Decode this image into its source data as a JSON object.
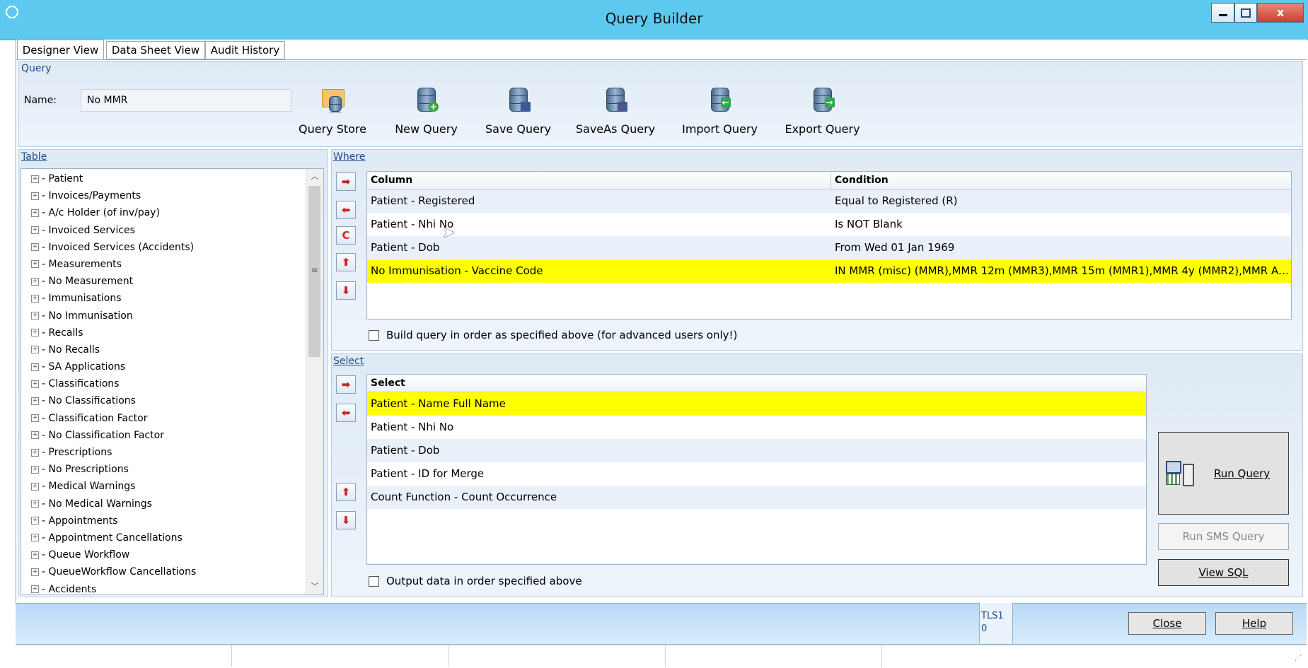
{
  "window": {
    "title": "Query Builder"
  },
  "tabs": [
    {
      "label": "Designer View"
    },
    {
      "label": "Data Sheet View"
    },
    {
      "label": "Audit History"
    }
  ],
  "query_section": {
    "label": "Query",
    "name_label": "Name:",
    "name_value": "No MMR"
  },
  "toolbar": [
    {
      "label": "Query Store",
      "icon": "folder-database-icon"
    },
    {
      "label": "New Query",
      "icon": "database-add-icon"
    },
    {
      "label": "Save Query",
      "icon": "database-save-icon"
    },
    {
      "label": "SaveAs Query",
      "icon": "database-saveas-icon"
    },
    {
      "label": "Import Query",
      "icon": "database-import-icon"
    },
    {
      "label": "Export Query",
      "icon": "database-export-icon"
    }
  ],
  "table_section": {
    "label": "Table",
    "items": [
      "Patient",
      "Invoices/Payments",
      "A/c Holder (of inv/pay)",
      "Invoiced Services",
      "Invoiced Services (Accidents)",
      "Measurements",
      "No Measurement",
      "Immunisations",
      "No Immunisation",
      "Recalls",
      "No Recalls",
      "SA Applications",
      "Classifications",
      "No Classifications",
      "Classification Factor",
      "No Classification Factor",
      "Prescriptions",
      "No Prescriptions",
      "Medical Warnings",
      "No Medical Warnings",
      "Appointments",
      "Appointment Cancellations",
      "Queue Workflow",
      "QueueWorkflow Cancellations",
      "Accidents"
    ]
  },
  "where_section": {
    "label": "Where",
    "headers": {
      "column": "Column",
      "condition": "Condition"
    },
    "rows": [
      {
        "column": "Patient - Registered",
        "condition": "Equal to Registered (R)"
      },
      {
        "column": "Patient - Nhi No",
        "condition": "Is NOT Blank"
      },
      {
        "column": "Patient - Dob",
        "condition": "From Wed 01 Jan 1969"
      },
      {
        "column": "No Immunisation - Vaccine Code",
        "condition": "IN MMR (misc) (MMR),MMR 12m (MMR3),MMR 15m (MMR1),MMR 4y (MMR2),MMR Ad..."
      }
    ],
    "side_buttons": {
      "add": "➡",
      "remove": "⬅",
      "clear": "C",
      "up": "⬆",
      "down": "⬇"
    },
    "checkbox_label": "Build query in order as specified above (for advanced users only!)"
  },
  "select_section": {
    "label": "Select",
    "header": "Select",
    "rows": [
      "Patient - Name Full Name",
      "Patient - Nhi No",
      "Patient - Dob",
      "Patient - ID for Merge",
      "Count Function - Count Occurrence"
    ],
    "checkbox_label": "Output data in order specified above"
  },
  "actions": {
    "run_query": "Run Query",
    "run_sms_query": "Run SMS Query",
    "view_sql": "View SQL",
    "close": "Close",
    "help": "Help"
  },
  "status": {
    "line1": "TLS1",
    "line2": "0"
  },
  "colors": {
    "titlebar": "#5ec9ef",
    "highlight": "#ffff00",
    "panel": "#dfeaf6"
  }
}
